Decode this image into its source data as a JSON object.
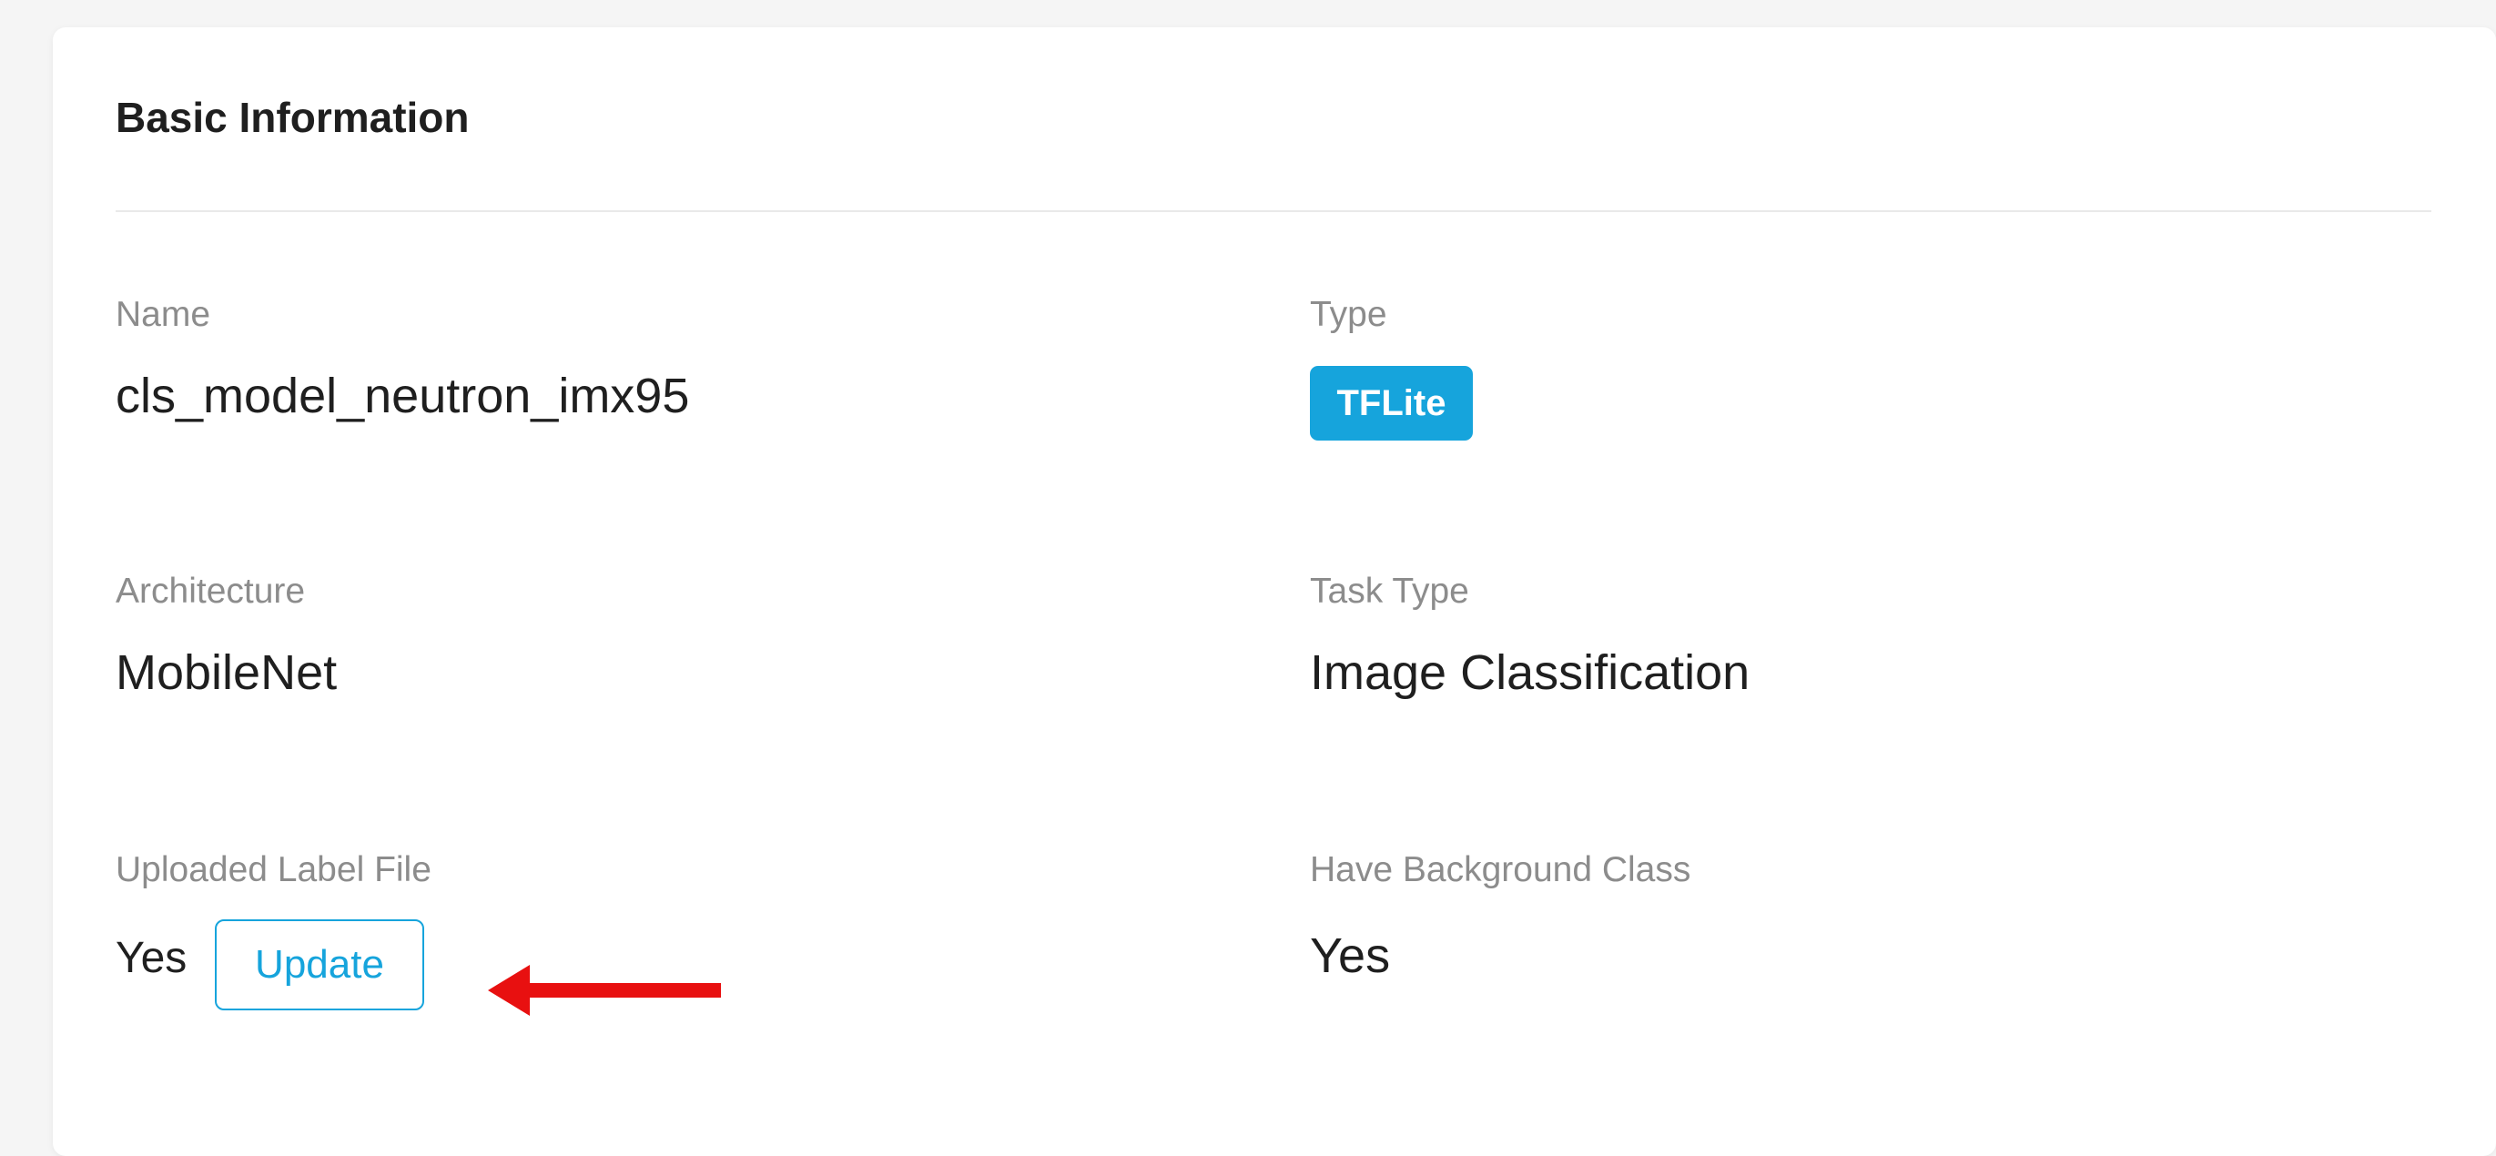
{
  "section": {
    "title": "Basic Information"
  },
  "fields": {
    "name": {
      "label": "Name",
      "value": "cls_model_neutron_imx95"
    },
    "type": {
      "label": "Type",
      "badge": "TFLite",
      "badge_color": "#16a4dc"
    },
    "architecture": {
      "label": "Architecture",
      "value": "MobileNet"
    },
    "task_type": {
      "label": "Task Type",
      "value": "Image Classification"
    },
    "uploaded_label_file": {
      "label": "Uploaded Label File",
      "value": "Yes",
      "update_label": "Update"
    },
    "background_class": {
      "label": "Have Background Class",
      "value": "Yes"
    }
  },
  "annotation": {
    "arrow_color": "#e81010",
    "icon": "arrow-left-icon"
  }
}
